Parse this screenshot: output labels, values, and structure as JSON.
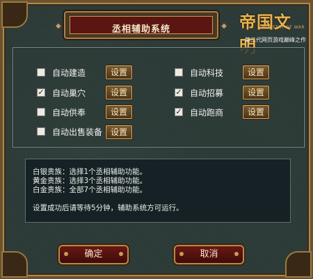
{
  "window": {
    "title": "丞相辅助系统",
    "logo_main": "帝国文明",
    "logo_sub": "MINISTRY OF WAR",
    "logo_tagline": "第二代网页游戏巅峰之作"
  },
  "options": [
    {
      "label": "自动建造",
      "checked": false,
      "button": "设置"
    },
    {
      "label": "自动科技",
      "checked": false,
      "button": "设置"
    },
    {
      "label": "自动巢穴",
      "checked": true,
      "button": "设置"
    },
    {
      "label": "自动招募",
      "checked": true,
      "button": "设置"
    },
    {
      "label": "自动供奉",
      "checked": false,
      "button": "设置"
    },
    {
      "label": "自动跑商",
      "checked": true,
      "button": "设置"
    },
    {
      "label": "自动出售装备",
      "checked": false,
      "button": "设置"
    }
  ],
  "info": {
    "line1": "白银贵族：选择1个丞相辅助功能。",
    "line2": "黄金贵族：选择3个丞相辅助功能。",
    "line3": "白金贵族：全部7个丞相辅助功能。",
    "line4": "设置成功后请等待5分钟，辅助系统方可运行。"
  },
  "buttons": {
    "confirm": "确定",
    "cancel": "取消"
  },
  "colors": {
    "panel_bg": "#2f3e3b",
    "frame": "#a98447",
    "title_bg": "#5b1512",
    "button_bg": "#6a1714"
  }
}
